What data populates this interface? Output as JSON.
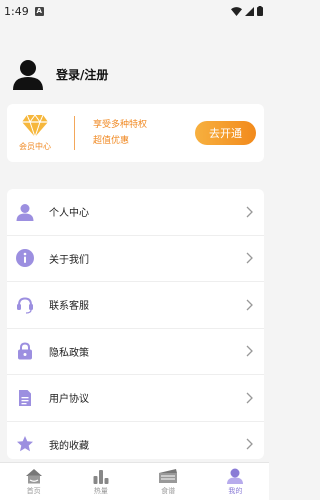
{
  "status": {
    "time": "1:49",
    "notif_letter": "A"
  },
  "profile": {
    "login_label": "登录/注册"
  },
  "vip": {
    "badge_label": "会员中心",
    "line1": "享受多种特权",
    "line2": "超值优惠",
    "button_label": "去开通",
    "accent": "#f08a24"
  },
  "menu": {
    "items": [
      {
        "label": "个人中心",
        "icon": "person-icon"
      },
      {
        "label": "关于我们",
        "icon": "info-icon"
      },
      {
        "label": "联系客服",
        "icon": "headset-icon"
      },
      {
        "label": "隐私政策",
        "icon": "lock-icon"
      },
      {
        "label": "用户协议",
        "icon": "document-icon"
      },
      {
        "label": "我的收藏",
        "icon": "star-icon"
      }
    ],
    "icon_color": "#9c8fe0"
  },
  "tabs": [
    {
      "label": "首页",
      "icon": "home-icon",
      "active": false
    },
    {
      "label": "热量",
      "icon": "bar-chart-icon",
      "active": false
    },
    {
      "label": "食谱",
      "icon": "recipe-icon",
      "active": false
    },
    {
      "label": "我的",
      "icon": "profile-icon",
      "active": true
    }
  ]
}
